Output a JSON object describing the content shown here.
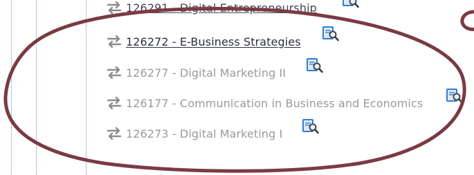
{
  "courses": [
    {
      "code_title": "126291 - Digital Entrepreneurship",
      "state": "link"
    },
    {
      "code_title": "126272 - E-Business Strategies",
      "state": "active"
    },
    {
      "code_title": "126277 - Digital Marketing II",
      "state": "disabled"
    },
    {
      "code_title": "126177 - Communication in Business and Economics",
      "state": "disabled"
    },
    {
      "code_title": "126273 - Digital Marketing I",
      "state": "disabled"
    }
  ],
  "icons": {
    "move": "swap-arrows-icon",
    "details": "document-magnifier-icon"
  },
  "colors": {
    "annotation_oval": "#7a3b43",
    "muted_text": "#9a9a9a",
    "active_text": "#2b2f3a",
    "tree_line": "#5b8fd6",
    "icon_blue": "#2d7fd3"
  }
}
